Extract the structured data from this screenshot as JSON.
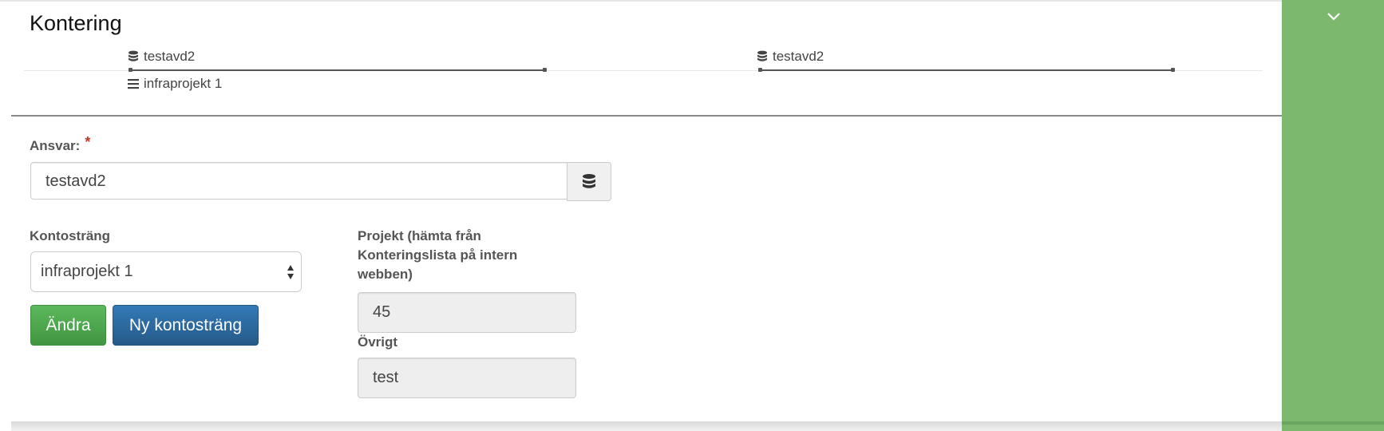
{
  "section_title": "Kontering",
  "tree": {
    "left_node": "testavd2",
    "child_node": "infraprojekt 1",
    "right_node": "testavd2"
  },
  "ansvar": {
    "label": "Ansvar:",
    "required_mark": "*",
    "value": "testavd2",
    "addon_icon": "database-icon"
  },
  "kontostrang": {
    "label": "Kontosträng",
    "selected": "infraprojekt 1"
  },
  "buttons": {
    "change": "Ändra",
    "new_account_string": "Ny kontosträng"
  },
  "projekt": {
    "label": "Projekt (hämta från Konteringslista på intern webben)",
    "value": "45"
  },
  "ovrigt": {
    "label": "Övrigt",
    "value": "test"
  },
  "colors": {
    "green_strip": "#7cb96f",
    "btn_success": "#5cb85c",
    "btn_primary": "#337ab7",
    "required": "#c0392b"
  },
  "side_toggle_icon": "chevron-down-icon"
}
